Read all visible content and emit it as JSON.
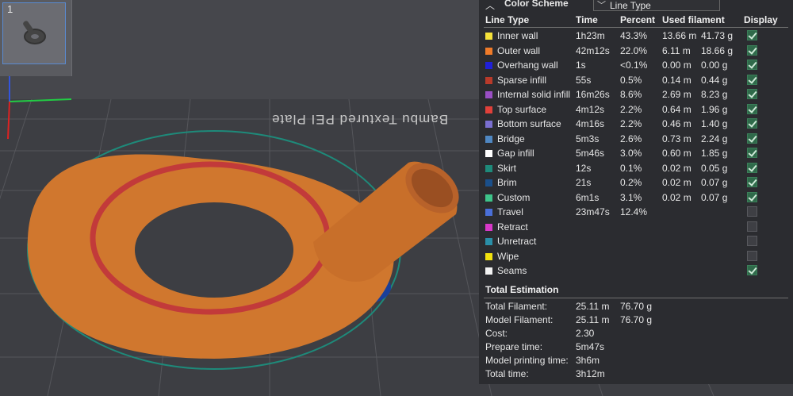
{
  "thumbnail": {
    "plate_number": "1"
  },
  "plate_text": "Bambu Textured PEI Plate",
  "color_scheme": {
    "label": "Color Scheme",
    "selected": "Line Type"
  },
  "table": {
    "headers": {
      "line_type": "Line Type",
      "time": "Time",
      "percent": "Percent",
      "used_filament": "Used filament",
      "display": "Display"
    },
    "rows": [
      {
        "name": "Inner wall",
        "color": "#f5e23a",
        "time": "1h23m",
        "percent": "43.3%",
        "length": "13.66 m",
        "weight": "41.73 g",
        "display": true
      },
      {
        "name": "Outer wall",
        "color": "#f07b29",
        "time": "42m12s",
        "percent": "22.0%",
        "length": "6.11 m",
        "weight": "18.66 g",
        "display": true
      },
      {
        "name": "Overhang wall",
        "color": "#2020d8",
        "time": "1s",
        "percent": "<0.1%",
        "length": "0.00 m",
        "weight": "0.00 g",
        "display": true
      },
      {
        "name": "Sparse infill",
        "color": "#b83a2a",
        "time": "55s",
        "percent": "0.5%",
        "length": "0.14 m",
        "weight": "0.44 g",
        "display": true
      },
      {
        "name": "Internal solid infill",
        "color": "#9a4fc4",
        "time": "16m26s",
        "percent": "8.6%",
        "length": "2.69 m",
        "weight": "8.23 g",
        "display": true
      },
      {
        "name": "Top surface",
        "color": "#e0403a",
        "time": "4m12s",
        "percent": "2.2%",
        "length": "0.64 m",
        "weight": "1.96 g",
        "display": true
      },
      {
        "name": "Bottom surface",
        "color": "#7a6fd0",
        "time": "4m16s",
        "percent": "2.2%",
        "length": "0.46 m",
        "weight": "1.40 g",
        "display": true
      },
      {
        "name": "Bridge",
        "color": "#4f87c2",
        "time": "5m3s",
        "percent": "2.6%",
        "length": "0.73 m",
        "weight": "2.24 g",
        "display": true
      },
      {
        "name": "Gap infill",
        "color": "#ffffff",
        "time": "5m46s",
        "percent": "3.0%",
        "length": "0.60 m",
        "weight": "1.85 g",
        "display": true
      },
      {
        "name": "Skirt",
        "color": "#1e8a7a",
        "time": "12s",
        "percent": "0.1%",
        "length": "0.02 m",
        "weight": "0.05 g",
        "display": true
      },
      {
        "name": "Brim",
        "color": "#1a4f8a",
        "time": "21s",
        "percent": "0.2%",
        "length": "0.02 m",
        "weight": "0.07 g",
        "display": true
      },
      {
        "name": "Custom",
        "color": "#3ec48a",
        "time": "6m1s",
        "percent": "3.1%",
        "length": "0.02 m",
        "weight": "0.07 g",
        "display": true
      },
      {
        "name": "Travel",
        "color": "#4a6fd8",
        "time": "23m47s",
        "percent": "12.4%",
        "length": "",
        "weight": "",
        "display": false
      },
      {
        "name": "Retract",
        "color": "#d838c8",
        "time": "",
        "percent": "",
        "length": "",
        "weight": "",
        "display": false
      },
      {
        "name": "Unretract",
        "color": "#2a8fa8",
        "time": "",
        "percent": "",
        "length": "",
        "weight": "",
        "display": false
      },
      {
        "name": "Wipe",
        "color": "#f2e20e",
        "time": "",
        "percent": "",
        "length": "",
        "weight": "",
        "display": false
      },
      {
        "name": "Seams",
        "color": "#f2f2f2",
        "time": "",
        "percent": "",
        "length": "",
        "weight": "",
        "display": true
      }
    ]
  },
  "total": {
    "title": "Total Estimation",
    "rows": [
      {
        "label": "Total Filament:",
        "v1": "25.11 m",
        "v2": "76.70 g"
      },
      {
        "label": "Model Filament:",
        "v1": "25.11 m",
        "v2": "76.70 g"
      },
      {
        "label": "Cost:",
        "v1": "2.30",
        "v2": ""
      },
      {
        "label": "Prepare time:",
        "v1": "5m47s",
        "v2": ""
      },
      {
        "label": "Model printing time:",
        "v1": "3h6m",
        "v2": ""
      },
      {
        "label": "Total time:",
        "v1": "3h12m",
        "v2": ""
      }
    ]
  }
}
